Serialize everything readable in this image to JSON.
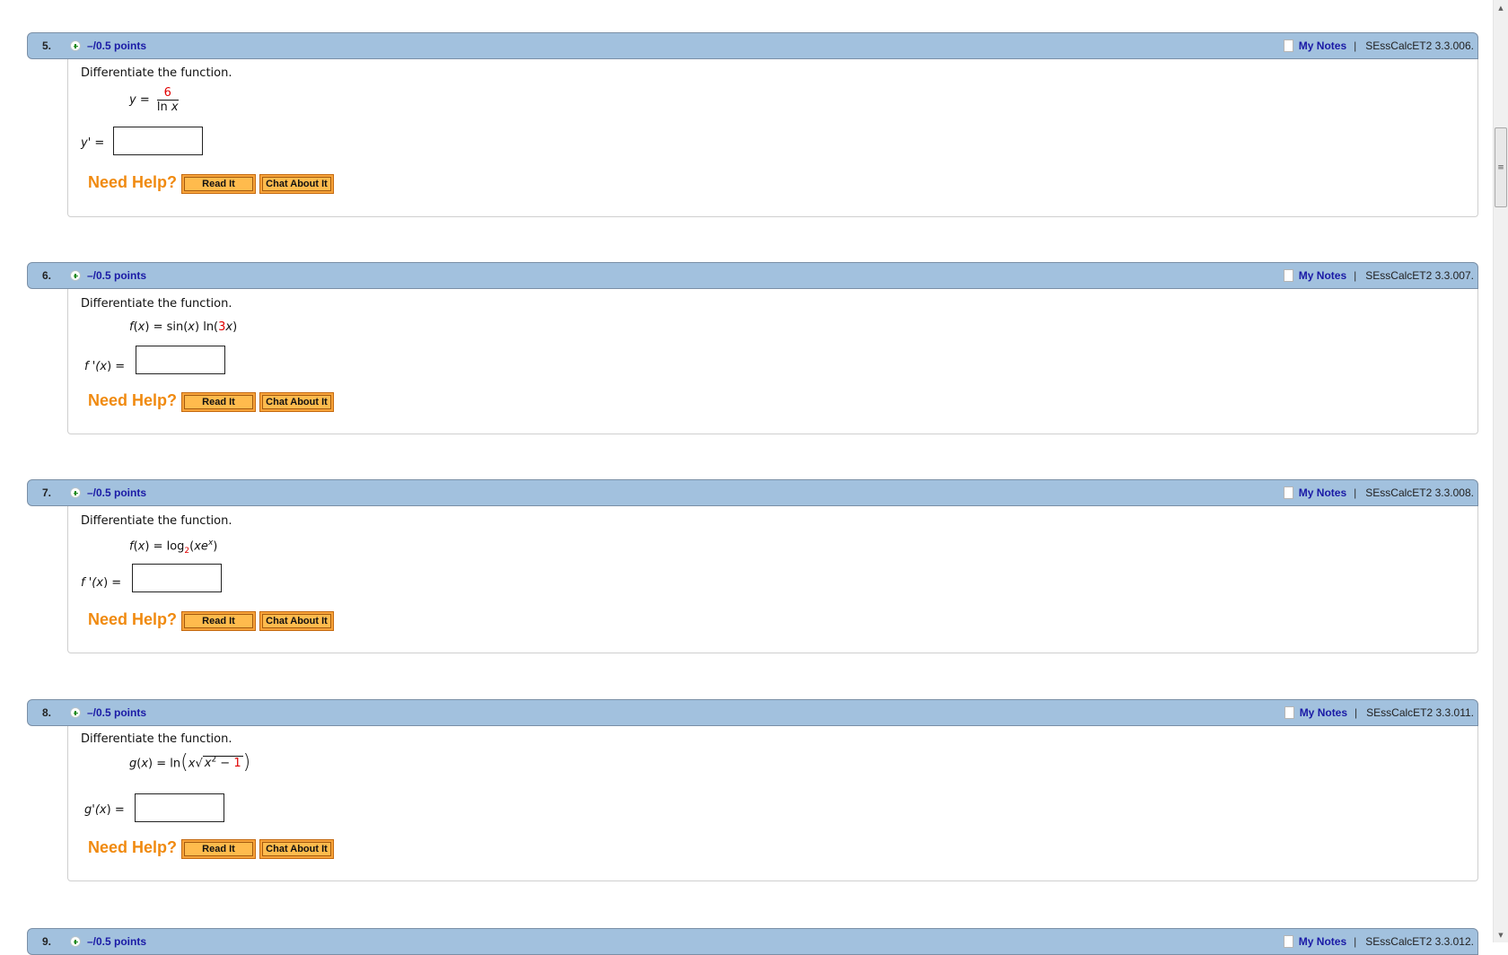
{
  "questions": [
    {
      "number": "5.",
      "points": "–/0.5 points",
      "my_notes": "My Notes",
      "separator": "|",
      "code": "SEssCalcET2 3.3.006.",
      "prompt": "Differentiate the function.",
      "equation": {
        "lhs": "y",
        "eq": " = ",
        "numerator": "6",
        "denominator_fn": "ln ",
        "denominator_var": "x"
      },
      "answer_label": {
        "fn": "y'",
        "eq": " ="
      },
      "answer_value": "",
      "need_help": "Need Help?",
      "read_it": "Read It",
      "chat_about_it": "Chat About It"
    },
    {
      "number": "6.",
      "points": "–/0.5 points",
      "my_notes": "My Notes",
      "separator": "|",
      "code": "SEssCalcET2 3.3.007.",
      "prompt": "Differentiate the function.",
      "equation": {
        "f": "f",
        "open": "(",
        "x": "x",
        "close": ")",
        "eq": " = sin(",
        "x2": "x",
        "mid": ") ln(",
        "coef": "3",
        "x3": "x",
        "end": ")"
      },
      "answer_label": {
        "fn": "f '(",
        "x": "x",
        "end": ") ="
      },
      "answer_value": "",
      "need_help": "Need Help?",
      "read_it": "Read It",
      "chat_about_it": "Chat About It"
    },
    {
      "number": "7.",
      "points": "–/0.5 points",
      "my_notes": "My Notes",
      "separator": "|",
      "code": "SEssCalcET2 3.3.008.",
      "prompt": "Differentiate the function.",
      "equation": {
        "f": "f",
        "open": "(",
        "x": "x",
        "close": ")",
        "eq": " = log",
        "base": "2",
        "arg_open": "(",
        "arg": "xe",
        "exp": "x",
        "arg_close": ")"
      },
      "answer_label": {
        "fn": "f '(",
        "x": "x",
        "end": ") ="
      },
      "answer_value": "",
      "need_help": "Need Help?",
      "read_it": "Read It",
      "chat_about_it": "Chat About It"
    },
    {
      "number": "8.",
      "points": "–/0.5 points",
      "my_notes": "My Notes",
      "separator": "|",
      "code": "SEssCalcET2 3.3.011.",
      "prompt": "Differentiate the function.",
      "equation": {
        "g": "g",
        "open": "(",
        "x": "x",
        "close": ")",
        "eq": " = ln",
        "lparen": "(",
        "x2": "x",
        "radicand_var": "x",
        "radicand_exp": "2",
        "minus": " − ",
        "const": "1",
        "rparen": ")"
      },
      "answer_label": {
        "fn": "g'(",
        "x": "x",
        "end": ") ="
      },
      "answer_value": "",
      "need_help": "Need Help?",
      "read_it": "Read It",
      "chat_about_it": "Chat About It"
    },
    {
      "number": "9.",
      "points": "–/0.5 points",
      "my_notes": "My Notes",
      "separator": "|",
      "code": "SEssCalcET2 3.3.012."
    }
  ],
  "scrollbar": {
    "up_icon": "▲",
    "down_icon": "▼",
    "grip_icon": "≡"
  }
}
